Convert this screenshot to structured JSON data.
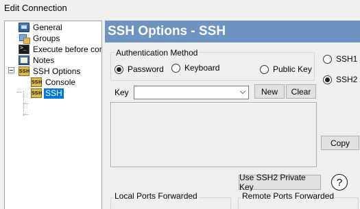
{
  "window": {
    "title": "Edit Connection"
  },
  "tree": {
    "items": [
      {
        "label": "General",
        "icon": "general-icon"
      },
      {
        "label": "Groups",
        "icon": "groups-icon"
      },
      {
        "label": "Execute before conn",
        "icon": "terminal-icon"
      },
      {
        "label": "Notes",
        "icon": "notes-icon"
      },
      {
        "label": "SSH Options",
        "icon": "ssh-icon"
      },
      {
        "label": "Console",
        "icon": "ssh-icon"
      },
      {
        "label": "SSH",
        "icon": "ssh-icon",
        "selected": true
      }
    ],
    "ssh_icon_text": "SSH"
  },
  "panel": {
    "header": "SSH Options - SSH",
    "auth": {
      "group_label": "Authentication Method",
      "options": [
        "Password",
        "Keyboard",
        "Public Key"
      ],
      "selected": "Password"
    },
    "protocol": {
      "options": [
        "SSH1",
        "SSH2"
      ],
      "selected": "SSH2"
    },
    "key": {
      "label": "Key",
      "value": "",
      "new_button": "New",
      "clear_button": "Clear"
    },
    "copy_button": "Copy",
    "use_key_button": "Use SSH2 Private Key",
    "help_glyph": "?",
    "local_ports_label": "Local Ports Forwarded",
    "remote_ports_label": "Remote Ports Forwarded"
  }
}
